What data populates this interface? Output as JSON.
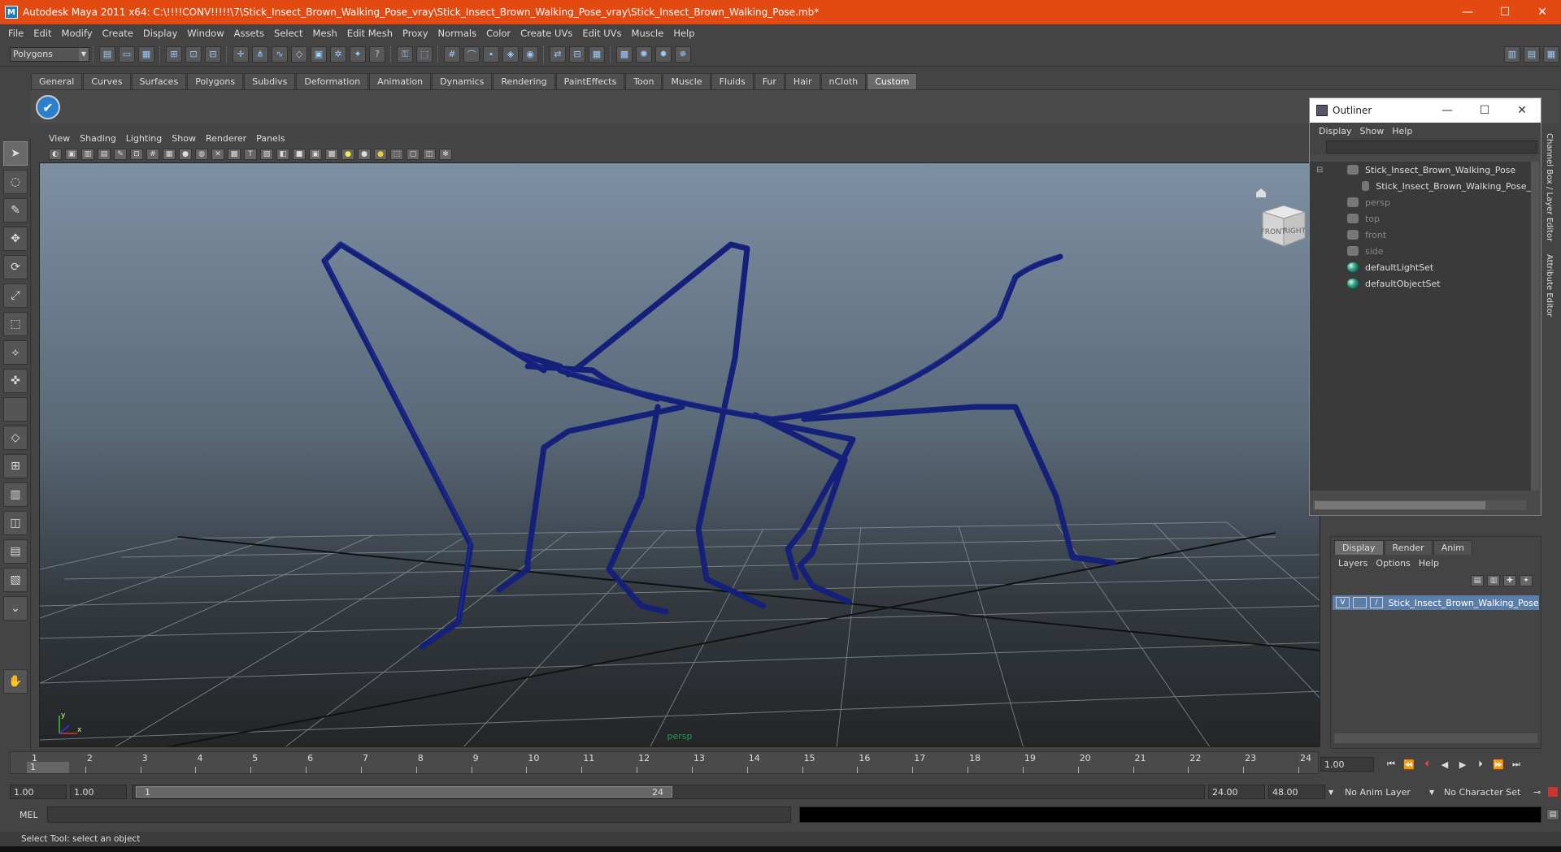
{
  "window": {
    "title": "Autodesk Maya 2011 x64: C:\\!!!!CONV!!!!!\\7\\Stick_Insect_Brown_Walking_Pose_vray\\Stick_Insect_Brown_Walking_Pose_vray\\Stick_Insect_Brown_Walking_Pose.mb*",
    "minimize": "—",
    "maximize": "☐",
    "close": "✕"
  },
  "menubar": [
    "File",
    "Edit",
    "Modify",
    "Create",
    "Display",
    "Window",
    "Assets",
    "Select",
    "Mesh",
    "Edit Mesh",
    "Proxy",
    "Normals",
    "Color",
    "Create UVs",
    "Edit UVs",
    "Muscle",
    "Help"
  ],
  "statusline": {
    "mode": "Polygons"
  },
  "shelf": {
    "tabs": [
      "General",
      "Curves",
      "Surfaces",
      "Polygons",
      "Subdivs",
      "Deformation",
      "Animation",
      "Dynamics",
      "Rendering",
      "PaintEffects",
      "Toon",
      "Muscle",
      "Fluids",
      "Fur",
      "Hair",
      "nCloth",
      "Custom"
    ],
    "active_tab": "Custom"
  },
  "viewport": {
    "menu": [
      "View",
      "Shading",
      "Lighting",
      "Show",
      "Renderer",
      "Panels"
    ],
    "camera_label": "persp",
    "viewcube": {
      "front": "FRONT",
      "right": "RIGHT"
    },
    "axis": {
      "x": "x",
      "y": "y"
    }
  },
  "outliner": {
    "title": "Outliner",
    "menu": [
      "Display",
      "Show",
      "Help"
    ],
    "items": [
      {
        "label": "Stick_Insect_Brown_Walking_Pose",
        "dim": false
      },
      {
        "label": "Stick_Insect_Brown_Walking_Pose_",
        "dim": false
      },
      {
        "label": "persp",
        "dim": true
      },
      {
        "label": "top",
        "dim": true
      },
      {
        "label": "front",
        "dim": true
      },
      {
        "label": "side",
        "dim": true
      },
      {
        "label": "defaultLightSet",
        "dim": false
      },
      {
        "label": "defaultObjectSet",
        "dim": false
      }
    ]
  },
  "side_tabs": [
    "Channel Box / Layer Editor",
    "Attribute Editor"
  ],
  "layer_editor": {
    "tabs": [
      "Display",
      "Render",
      "Anim"
    ],
    "menu": [
      "Layers",
      "Options",
      "Help"
    ],
    "layer": {
      "visible": "V",
      "name": "Stick_Insect_Brown_Walking_Pose_la"
    }
  },
  "timeline": {
    "ticks": [
      "1",
      "2",
      "3",
      "4",
      "5",
      "6",
      "7",
      "8",
      "9",
      "10",
      "11",
      "12",
      "13",
      "14",
      "15",
      "16",
      "17",
      "18",
      "19",
      "20",
      "21",
      "22",
      "23",
      "24"
    ],
    "current": "1",
    "current_frame_field": "1.00"
  },
  "range": {
    "start": "1.00",
    "playback_start": "1.00",
    "thumb_start": "1",
    "thumb_end": "24",
    "playback_end": "24.00",
    "end": "48.00",
    "anim_layer": "No Anim Layer",
    "character_set": "No Character Set"
  },
  "command": {
    "label": "MEL"
  },
  "helpline": "Select Tool: select an object",
  "colors": {
    "titlebar": "#e24a12",
    "wireframe": "#14207a",
    "selected_layer": "#5a7ea8"
  }
}
